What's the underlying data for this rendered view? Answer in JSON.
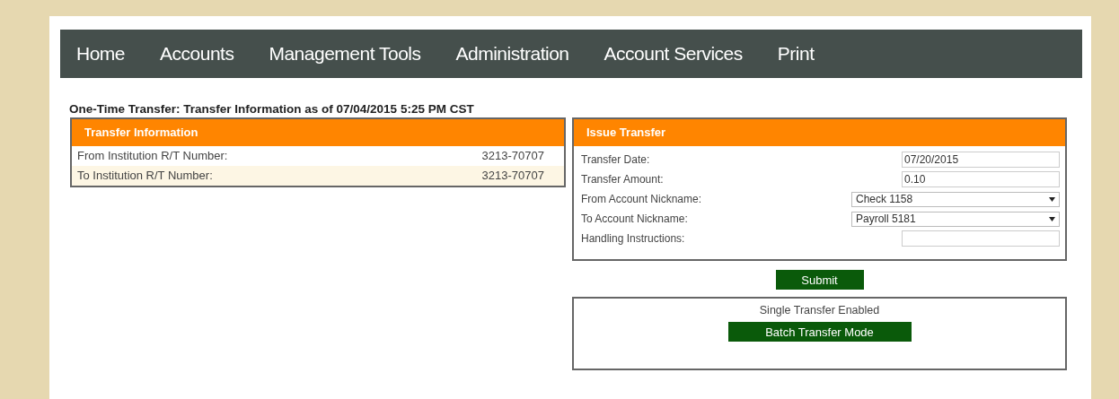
{
  "nav": [
    {
      "label": "Home"
    },
    {
      "label": "Accounts"
    },
    {
      "label": "Management Tools"
    },
    {
      "label": "Administration"
    },
    {
      "label": "Account Services"
    },
    {
      "label": "Print"
    }
  ],
  "page_title": "One-Time Transfer: Transfer Information as of 07/04/2015 5:25 PM CST",
  "transfer_information": {
    "title": "Transfer Information",
    "rows": [
      {
        "label": "From Institution R/T Number:",
        "value": "3213-70707"
      },
      {
        "label": "To Institution R/T Number:",
        "value": "3213-70707"
      }
    ]
  },
  "issue_transfer": {
    "title": "Issue Transfer",
    "fields": [
      {
        "kind": "text",
        "label": "Transfer Date:",
        "value": "07/20/2015"
      },
      {
        "kind": "text",
        "label": "Transfer Amount:",
        "value": "0.10"
      },
      {
        "kind": "select",
        "label": "From Account Nickname:",
        "value": "Check 1158"
      },
      {
        "kind": "select",
        "label": "To Account Nickname:",
        "value": "Payroll 5181"
      },
      {
        "kind": "text",
        "label": "Handling Instructions:"
      }
    ]
  },
  "submit_button": "Submit",
  "mode_panel": {
    "status": "Single Transfer Enabled",
    "button": "Batch Transfer Mode"
  }
}
